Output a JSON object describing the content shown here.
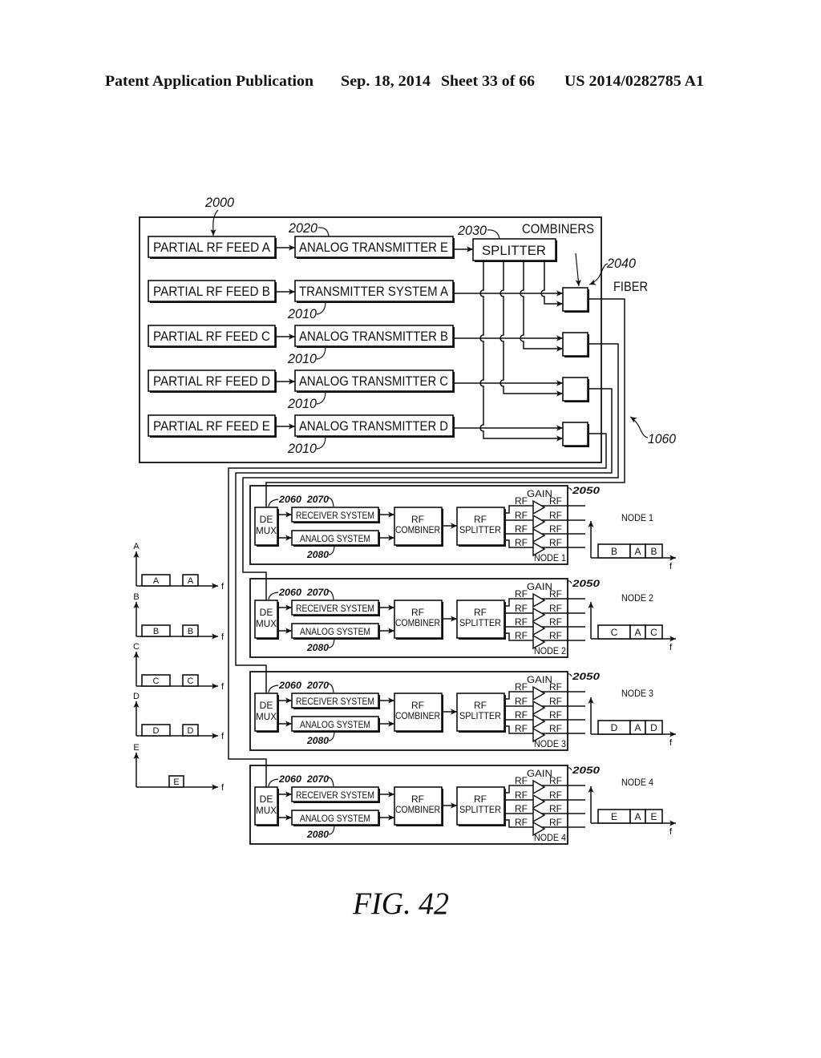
{
  "header": {
    "publication": "Patent Application Publication",
    "date": "Sep. 18, 2014",
    "sheet": "Sheet 33 of 66",
    "pub_number": "US 2014/0282785 A1"
  },
  "headend": {
    "ref": "2000",
    "system_ref": "1060",
    "rows": [
      {
        "feed": "PARTIAL RF FEED A",
        "transmitter": "ANALOG TRANSMITTER E",
        "ref": "2020"
      },
      {
        "feed": "PARTIAL RF FEED B",
        "transmitter": "TRANSMITTER SYSTEM A",
        "ref": "2010"
      },
      {
        "feed": "PARTIAL RF FEED C",
        "transmitter": "ANALOG TRANSMITTER B",
        "ref": "2010"
      },
      {
        "feed": "PARTIAL RF FEED D",
        "transmitter": "ANALOG TRANSMITTER C",
        "ref": "2010"
      },
      {
        "feed": "PARTIAL RF FEED E",
        "transmitter": "ANALOG TRANSMITTER D",
        "ref": "2010"
      }
    ],
    "splitter": {
      "label": "SPLITTER",
      "ref": "2030"
    },
    "combiners": {
      "label": "COMBINERS",
      "ref": "2040"
    },
    "fiber_label": "FIBER"
  },
  "input_spectra": {
    "axis_label": "f",
    "items": [
      {
        "label": "A",
        "bands": [
          "A",
          "A"
        ]
      },
      {
        "label": "B",
        "bands": [
          "B",
          "B"
        ]
      },
      {
        "label": "C",
        "bands": [
          "C",
          "C"
        ]
      },
      {
        "label": "D",
        "bands": [
          "D",
          "D"
        ]
      },
      {
        "label": "E",
        "bands": [
          "E"
        ]
      }
    ]
  },
  "node_common": {
    "demux": [
      "DE",
      "MUX"
    ],
    "demux_ref": "2060",
    "receiver": "RECEIVER SYSTEM",
    "receiver_ref": "2070",
    "analog": "ANALOG SYSTEM",
    "analog_ref": "2080",
    "combiner": [
      "RF",
      "COMBINER"
    ],
    "splitter": [
      "RF",
      "SPLITTER"
    ],
    "gain": "GAIN",
    "rf": "RF",
    "axis_label": "f"
  },
  "nodes": [
    {
      "name": "NODE 1",
      "ref": "2050",
      "spectrum": [
        "B",
        "A",
        "B"
      ]
    },
    {
      "name": "NODE 2",
      "ref": "2050",
      "spectrum": [
        "C",
        "A",
        "C"
      ]
    },
    {
      "name": "NODE 3",
      "ref": "2050",
      "spectrum": [
        "D",
        "A",
        "D"
      ]
    },
    {
      "name": "NODE 4",
      "ref": "2050",
      "spectrum": [
        "E",
        "A",
        "E"
      ]
    }
  ],
  "figure_caption": "FIG. 42"
}
